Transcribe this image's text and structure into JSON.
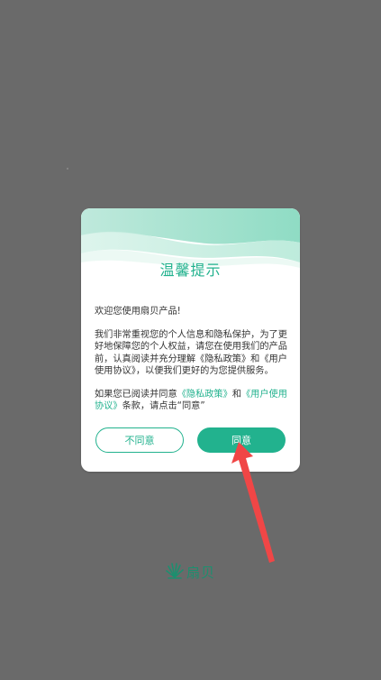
{
  "dialog": {
    "title": "温馨提示",
    "greeting": "欢迎您使用扇贝产品!",
    "main_text": "我们非常重视您的个人信息和隐私保护，为了更好地保障您的个人权益，请您在使用我们的产品前，认真阅读并充分理解《隐私政策》和《用户使用协议》，以便我们更好的为您提供服务。",
    "consent_prefix": "如果您已阅读并同意",
    "privacy_link": "《隐私政策》",
    "consent_and": "和",
    "user_agreement_link": "《用户使用协议》",
    "consent_suffix": "条款，请点击“同意”",
    "disagree_label": "不同意",
    "agree_label": "同意"
  },
  "logo": {
    "text": "扇贝"
  },
  "colors": {
    "accent": "#22b28e",
    "overlay": "#6a6a6a",
    "arrow": "#f04646"
  }
}
